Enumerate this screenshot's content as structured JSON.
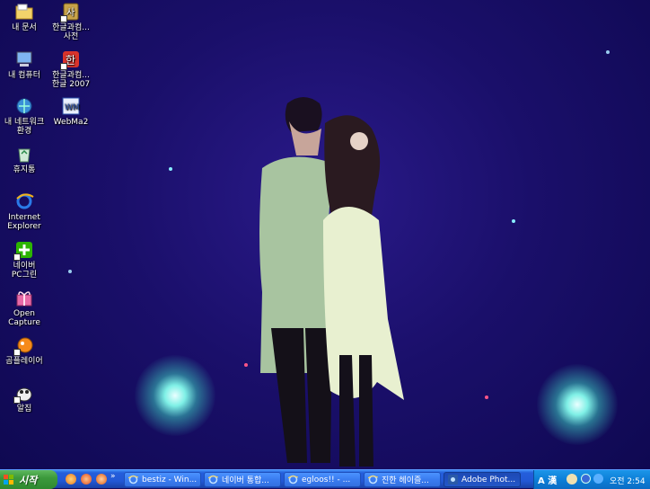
{
  "desktop_icons": [
    {
      "name": "my-documents",
      "label": "내 문서",
      "icon": "folder-icon"
    },
    {
      "name": "hangul-dictionary",
      "label": "한글과컴...\n사전",
      "icon": "dictionary-icon"
    },
    {
      "name": "my-computer",
      "label": "내 컴퓨터",
      "icon": "computer-icon"
    },
    {
      "name": "hangul-2007",
      "label": "한글과컴...\n한글 2007",
      "icon": "hangul-icon"
    },
    {
      "name": "my-network",
      "label": "내 네트워크\n환경",
      "icon": "network-icon"
    },
    {
      "name": "webma2",
      "label": "WebMa2",
      "icon": "webma-icon"
    },
    {
      "name": "recycle-bin",
      "label": "휴지통",
      "icon": "recycle-bin-icon"
    },
    {
      "name": "internet-explorer",
      "label": "Internet\nExplorer",
      "icon": "ie-icon"
    },
    {
      "name": "naver-pc-green",
      "label": "네이버\nPC그린",
      "icon": "naver-icon"
    },
    {
      "name": "open-capture",
      "label": "Open\nCapture",
      "icon": "gift-icon"
    },
    {
      "name": "gom-player",
      "label": "곰플레이어",
      "icon": "gom-icon"
    },
    {
      "name": "alzip",
      "label": "알집",
      "icon": "alzip-icon"
    }
  ],
  "taskbar": {
    "start_label": "시작",
    "quick_launch_more": "»",
    "tasks": [
      {
        "label": "bestiz - Win...",
        "icon": "ie-icon"
      },
      {
        "label": "네이버 통합...",
        "icon": "ie-icon"
      },
      {
        "label": "egloos!! - ...",
        "icon": "ie-icon"
      },
      {
        "label": "진한 헤이즐...",
        "icon": "ie-icon"
      },
      {
        "label": "Adobe Phot...",
        "icon": "photoshop-icon"
      }
    ],
    "tray": {
      "ime_label": "A 漢",
      "clock": "오전 2:54"
    }
  },
  "colors": {
    "taskbar": "#245edb",
    "start": "#3c9a3c",
    "tray": "#0d7fd8",
    "wallpaper": "#1a0f6a"
  }
}
